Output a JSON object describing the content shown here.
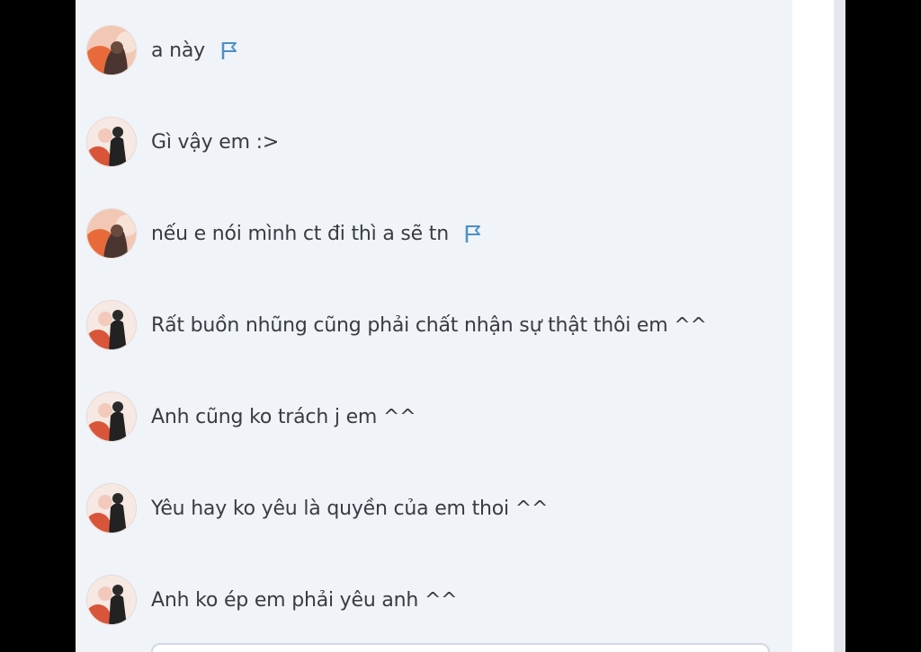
{
  "messages": [
    {
      "sender": "her",
      "text": "a này",
      "flag": true
    },
    {
      "sender": "him",
      "text": "Gì vậy em :>",
      "flag": false
    },
    {
      "sender": "her",
      "text": "nếu e nói mình ct đi thì a sẽ tn",
      "flag": true
    },
    {
      "sender": "him",
      "text": "Rất buồn nhũng cũng phải chất nhận sự thật thôi em ^^",
      "flag": false
    },
    {
      "sender": "him",
      "text": "Anh cũng ko trách j em ^^",
      "flag": false
    },
    {
      "sender": "him",
      "text": "Yêu hay ko yêu là quyền của em thoi ^^",
      "flag": false
    },
    {
      "sender": "him",
      "text": "Anh ko ép em phải yêu anh ^^",
      "flag": false
    }
  ],
  "icons": {
    "flag": "flag-icon",
    "avatar_her": "avatar-girl",
    "avatar_him": "avatar-boy"
  },
  "colors": {
    "panel_bg": "#f0f3f8",
    "text": "#383c42",
    "flag": "#4a90c8",
    "frame": "#000000"
  }
}
